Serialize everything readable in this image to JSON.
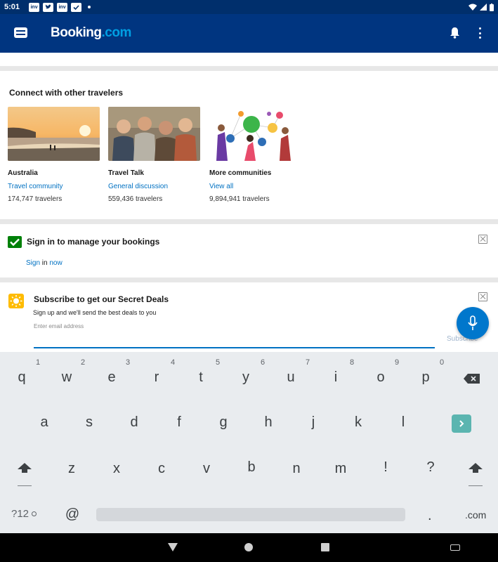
{
  "status_bar": {
    "time": "5:01",
    "icons": [
      "inv",
      "twitter-icon",
      "inv",
      "shield-check-icon"
    ],
    "notification_labels": [
      "inv",
      "inv"
    ]
  },
  "app_bar": {
    "logo_main": "Booking",
    "logo_suffix": ".com"
  },
  "connect": {
    "title": "Connect with other travelers",
    "cards": [
      {
        "title": "Australia",
        "subtitle": "Travel community",
        "count": "174,747",
        "count_suffix": "travelers"
      },
      {
        "title": "Travel Talk",
        "subtitle": "General discussion",
        "count": "559,436",
        "count_suffix": "travelers"
      },
      {
        "title": "More communities",
        "subtitle": "View all",
        "count": "9,894,941",
        "count_suffix": "travelers"
      }
    ]
  },
  "signin": {
    "title": "Sign in to manage your bookings",
    "link_text": "Sign",
    "middle_text": "in",
    "trailing_link": "now"
  },
  "subscribe": {
    "title": "Subscribe to get our Secret Deals",
    "description_parts": [
      "Sign up and we'll send the best deals",
      "to",
      "you"
    ],
    "placeholder": "Enter email address",
    "button_label": "Subscribe"
  },
  "keyboard": {
    "number_hints": [
      "1",
      "2",
      "3",
      "4",
      "5",
      "6",
      "7",
      "8",
      "9",
      "0"
    ],
    "row1": [
      "q",
      "w",
      "e",
      "r",
      "t",
      "y",
      "u",
      "i",
      "o",
      "p"
    ],
    "row2": [
      "a",
      "s",
      "d",
      "f",
      "g",
      "h",
      "j",
      "k",
      "l"
    ],
    "row3": [
      "z",
      "x",
      "c",
      "v",
      "b",
      "n",
      "m",
      "!",
      "?"
    ],
    "mode_key": "?12",
    "at_key": "@",
    "period_key": ".",
    "dotcom_key": ".com"
  },
  "colors": {
    "brand_blue": "#003580",
    "link_blue": "#0071c2",
    "check_green": "#008009",
    "deal_yellow": "#febb02"
  }
}
